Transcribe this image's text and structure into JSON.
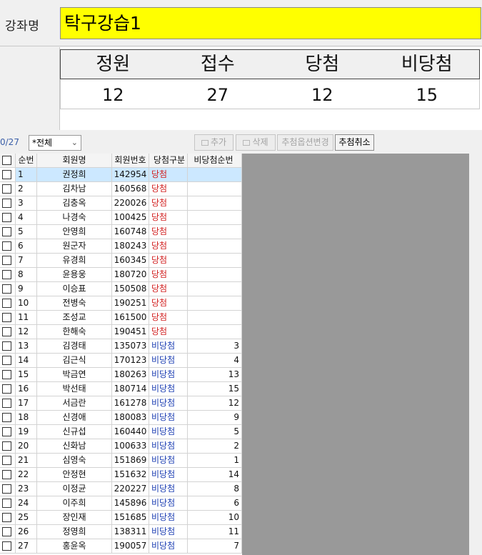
{
  "lecture": {
    "label": "강좌명",
    "name": "탁구강습1"
  },
  "stats": {
    "headers": [
      "정원",
      "접수",
      "당첨",
      "비당첨"
    ],
    "values": [
      "12",
      "27",
      "12",
      "15"
    ]
  },
  "toolbar": {
    "count": "0/27",
    "filter_value": "*전체",
    "add_label": "추가",
    "delete_label": "삭제",
    "option_label": "추첨옵션변경",
    "cancel_label": "추첨취소"
  },
  "grid": {
    "columns": [
      "순번",
      "회원명",
      "회원번호",
      "당첨구분",
      "비당첨순번"
    ],
    "rows": [
      {
        "no": "1",
        "name": "권정희",
        "member": "142954",
        "result": "당첨",
        "rank": ""
      },
      {
        "no": "2",
        "name": "김차남",
        "member": "160568",
        "result": "당첨",
        "rank": ""
      },
      {
        "no": "3",
        "name": "김충옥",
        "member": "220026",
        "result": "당첨",
        "rank": ""
      },
      {
        "no": "4",
        "name": "나경숙",
        "member": "100425",
        "result": "당첨",
        "rank": ""
      },
      {
        "no": "5",
        "name": "안영희",
        "member": "160748",
        "result": "당첨",
        "rank": ""
      },
      {
        "no": "6",
        "name": "원군자",
        "member": "180243",
        "result": "당첨",
        "rank": ""
      },
      {
        "no": "7",
        "name": "유경희",
        "member": "160345",
        "result": "당첨",
        "rank": ""
      },
      {
        "no": "8",
        "name": "윤용웅",
        "member": "180720",
        "result": "당첨",
        "rank": ""
      },
      {
        "no": "9",
        "name": "이승표",
        "member": "150508",
        "result": "당첨",
        "rank": ""
      },
      {
        "no": "10",
        "name": "전병숙",
        "member": "190251",
        "result": "당첨",
        "rank": ""
      },
      {
        "no": "11",
        "name": "조성교",
        "member": "161500",
        "result": "당첨",
        "rank": ""
      },
      {
        "no": "12",
        "name": "한해숙",
        "member": "190451",
        "result": "당첨",
        "rank": ""
      },
      {
        "no": "13",
        "name": "김경태",
        "member": "135073",
        "result": "비당첨",
        "rank": "3"
      },
      {
        "no": "14",
        "name": "김근식",
        "member": "170123",
        "result": "비당첨",
        "rank": "4"
      },
      {
        "no": "15",
        "name": "박금연",
        "member": "180263",
        "result": "비당첨",
        "rank": "13"
      },
      {
        "no": "16",
        "name": "박선태",
        "member": "180714",
        "result": "비당첨",
        "rank": "15"
      },
      {
        "no": "17",
        "name": "서금란",
        "member": "161278",
        "result": "비당첨",
        "rank": "12"
      },
      {
        "no": "18",
        "name": "신경애",
        "member": "180083",
        "result": "비당첨",
        "rank": "9"
      },
      {
        "no": "19",
        "name": "신규섭",
        "member": "160440",
        "result": "비당첨",
        "rank": "5"
      },
      {
        "no": "20",
        "name": "신화남",
        "member": "100633",
        "result": "비당첨",
        "rank": "2"
      },
      {
        "no": "21",
        "name": "심영숙",
        "member": "151869",
        "result": "비당첨",
        "rank": "1"
      },
      {
        "no": "22",
        "name": "안정현",
        "member": "151632",
        "result": "비당첨",
        "rank": "14"
      },
      {
        "no": "23",
        "name": "이정균",
        "member": "220227",
        "result": "비당첨",
        "rank": "8"
      },
      {
        "no": "24",
        "name": "이주희",
        "member": "145896",
        "result": "비당첨",
        "rank": "6"
      },
      {
        "no": "25",
        "name": "장인재",
        "member": "151685",
        "result": "비당첨",
        "rank": "10"
      },
      {
        "no": "26",
        "name": "정영희",
        "member": "138311",
        "result": "비당첨",
        "rank": "11"
      },
      {
        "no": "27",
        "name": "홍윤옥",
        "member": "190057",
        "result": "비당첨",
        "rank": "7"
      }
    ]
  },
  "colors": {
    "highlight": "#ffff00",
    "selected_row": "#cce8ff",
    "win": "#d11f1f",
    "lose": "#1d3fb3"
  }
}
